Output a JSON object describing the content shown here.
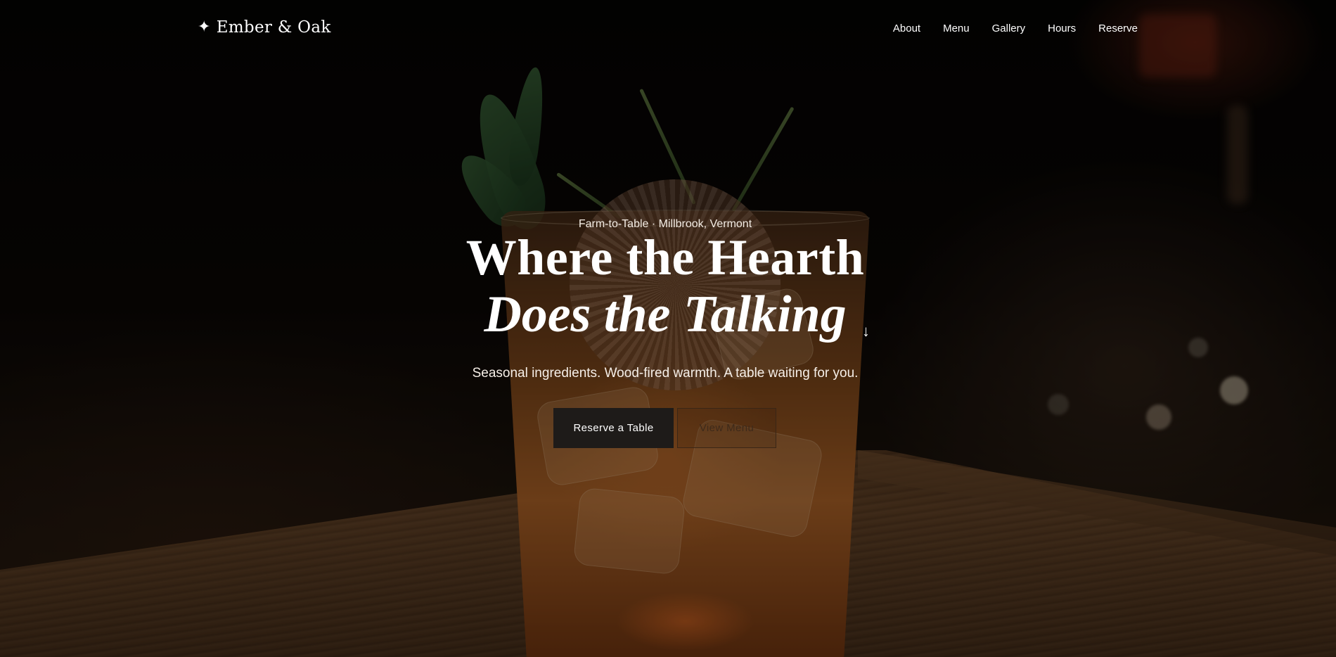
{
  "brand": {
    "icon": "sparkle-icon",
    "icon_glyph": "✦",
    "name": "Ember & Oak"
  },
  "nav": {
    "items": [
      {
        "label": "About"
      },
      {
        "label": "Menu"
      },
      {
        "label": "Gallery"
      },
      {
        "label": "Hours"
      },
      {
        "label": "Reserve"
      }
    ]
  },
  "hero": {
    "eyebrow": "Farm-to-Table · Millbrook, Vermont",
    "headline_line1": "Where the Hearth",
    "headline_line2": "Does the Talking",
    "tagline": "Seasonal ingredients. Wood-fired warmth. A table waiting for you.",
    "scroll_icon": "arrow-down-icon",
    "scroll_glyph": "↓",
    "primary_cta": "Reserve a Table",
    "secondary_cta": "View Menu"
  },
  "colors": {
    "text": "#ffffff",
    "primary_button_bg": "#1e1b19",
    "secondary_button_text": "#3e2a1a",
    "secondary_button_border": "#3a2616"
  }
}
